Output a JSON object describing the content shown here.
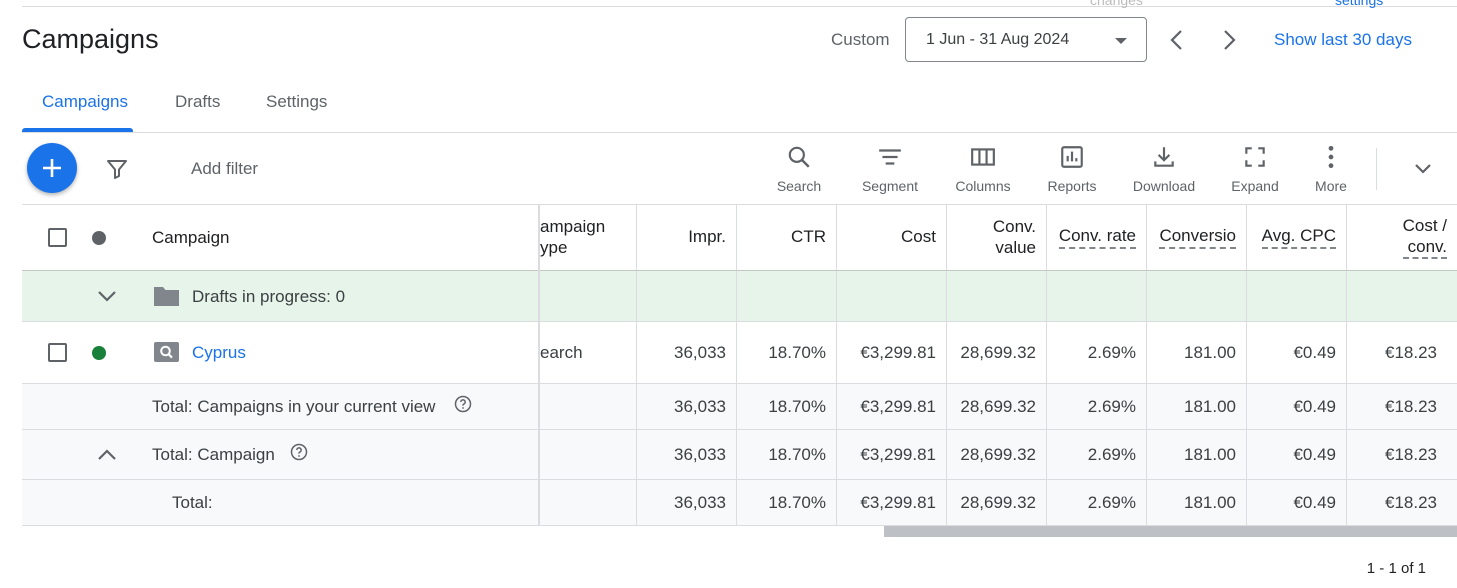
{
  "page": {
    "title": "Campaigns",
    "cut_top_left": "changes",
    "cut_top_right": "settings"
  },
  "daterange": {
    "mode_label": "Custom",
    "value": "1 Jun - 31 Aug 2024",
    "show_last_label": "Show last 30 days"
  },
  "tabs": [
    {
      "label": "Campaigns",
      "active": true
    },
    {
      "label": "Drafts",
      "active": false
    },
    {
      "label": "Settings",
      "active": false
    }
  ],
  "toolbar": {
    "add_filter": "Add filter",
    "tools": [
      {
        "label": "Search",
        "icon": "search-icon"
      },
      {
        "label": "Segment",
        "icon": "segment-icon"
      },
      {
        "label": "Columns",
        "icon": "columns-icon"
      },
      {
        "label": "Reports",
        "icon": "reports-icon"
      },
      {
        "label": "Download",
        "icon": "download-icon"
      },
      {
        "label": "Expand",
        "icon": "expand-icon"
      },
      {
        "label": "More",
        "icon": "more-vert-icon"
      }
    ]
  },
  "table": {
    "headers": {
      "campaign": "Campaign",
      "campaign_type_line1": "ampaign",
      "campaign_type_line2": "ype",
      "impr": "Impr.",
      "ctr": "CTR",
      "cost": "Cost",
      "conv_value_line1": "Conv.",
      "conv_value_line2": "value",
      "conv_rate": "Conv. rate",
      "conversions": "Conversio",
      "avg_cpc": "Avg. CPC",
      "cost_conv_line1": "Cost /",
      "cost_conv_line2": "conv."
    },
    "drafts_label": "Drafts in progress: 0",
    "rows": [
      {
        "campaign": "Cyprus",
        "type": "earch",
        "impr": "36,033",
        "ctr": "18.70%",
        "cost": "€3,299.81",
        "conv_value": "28,699.32",
        "conv_rate": "2.69%",
        "conversions": "181.00",
        "avg_cpc": "€0.49",
        "cost_conv": "€18.23"
      }
    ],
    "totals": [
      {
        "label": "Total: Campaigns in your current view",
        "impr": "36,033",
        "ctr": "18.70%",
        "cost": "€3,299.81",
        "conv_value": "28,699.32",
        "conv_rate": "2.69%",
        "conversions": "181.00",
        "avg_cpc": "€0.49",
        "cost_conv": "€18.23"
      },
      {
        "label": "Total: Campaign",
        "impr": "36,033",
        "ctr": "18.70%",
        "cost": "€3,299.81",
        "conv_value": "28,699.32",
        "conv_rate": "2.69%",
        "conversions": "181.00",
        "avg_cpc": "€0.49",
        "cost_conv": "€18.23"
      },
      {
        "label": "Total:",
        "impr": "36,033",
        "ctr": "18.70%",
        "cost": "€3,299.81",
        "conv_value": "28,699.32",
        "conv_rate": "2.69%",
        "conversions": "181.00",
        "avg_cpc": "€0.49",
        "cost_conv": "€18.23"
      }
    ]
  },
  "pagination": "1 - 1 of 1",
  "colors": {
    "accent": "#1a73e8",
    "status_enabled": "#188038",
    "drafts_bg": "#e6f4ea"
  }
}
